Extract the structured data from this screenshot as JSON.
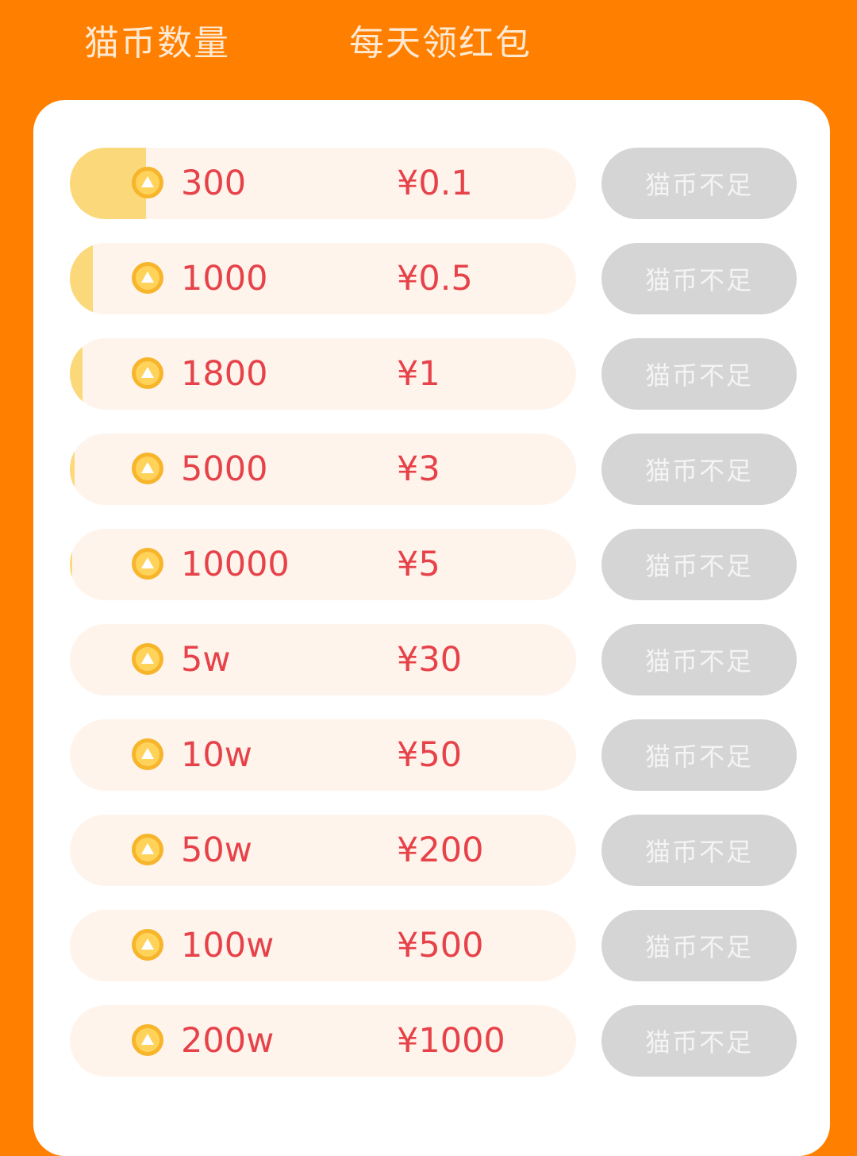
{
  "header": {
    "coins_title": "猫币数量",
    "daily_title": "每天领红包"
  },
  "colors": {
    "background": "#FF7F00",
    "accent_text": "#E64249",
    "progress_fill": "#FBD97A",
    "button_disabled": "#D5D5D5"
  },
  "rows": [
    {
      "coins": "300",
      "reward": "¥0.1",
      "button": "猫币不足",
      "progress": 0.15
    },
    {
      "coins": "1000",
      "reward": "¥0.5",
      "button": "猫币不足",
      "progress": 0.045
    },
    {
      "coins": "1800",
      "reward": "¥1",
      "button": "猫币不足",
      "progress": 0.025
    },
    {
      "coins": "5000",
      "reward": "¥3",
      "button": "猫币不足",
      "progress": 0.009
    },
    {
      "coins": "10000",
      "reward": "¥5",
      "button": "猫币不足",
      "progress": 0.0045
    },
    {
      "coins": "5w",
      "reward": "¥30",
      "button": "猫币不足",
      "progress": 0.0
    },
    {
      "coins": "10w",
      "reward": "¥50",
      "button": "猫币不足",
      "progress": 0.0
    },
    {
      "coins": "50w",
      "reward": "¥200",
      "button": "猫币不足",
      "progress": 0.0
    },
    {
      "coins": "100w",
      "reward": "¥500",
      "button": "猫币不足",
      "progress": 0.0
    },
    {
      "coins": "200w",
      "reward": "¥1000",
      "button": "猫币不足",
      "progress": 0.0
    }
  ]
}
